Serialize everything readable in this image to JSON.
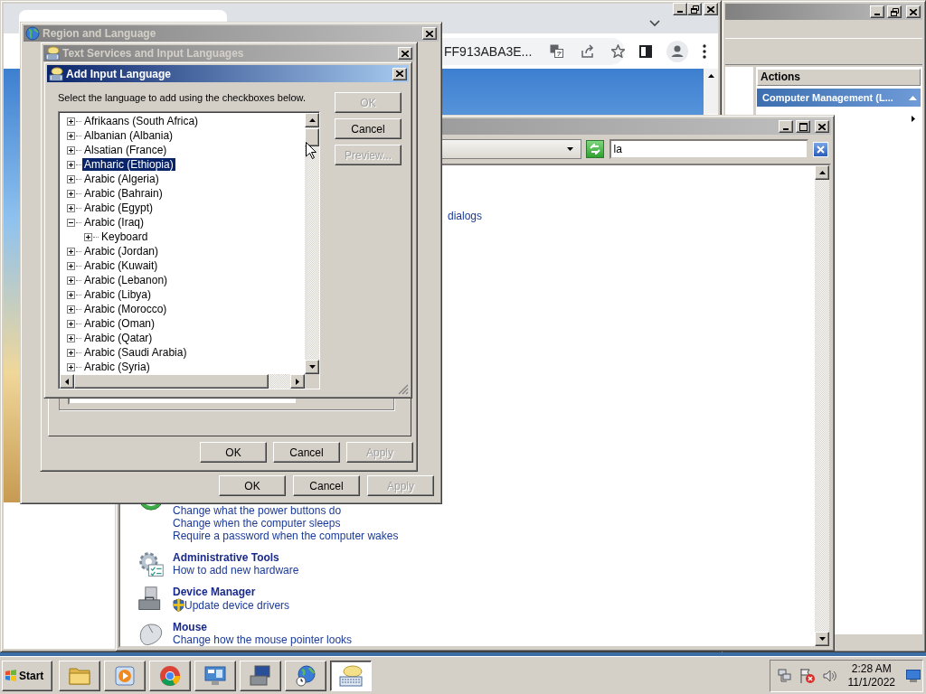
{
  "browser_window": {
    "address_fragment": "FF913ABA3E..."
  },
  "management_window": {
    "actions_heading": "Actions",
    "actions_section": {
      "label": "Computer Management (L...",
      "expanded": true
    }
  },
  "control_panel": {
    "search": {
      "value": "la"
    },
    "link_fragment": "dialogs",
    "sections": [
      {
        "kind": "power",
        "links": [
          {
            "text": "Change what the power buttons do",
            "shield": false
          },
          {
            "text": "Change when the computer sleeps",
            "shield": false
          },
          {
            "text": "Require a password when the computer wakes",
            "shield": false
          }
        ]
      },
      {
        "kind": "admin-tools",
        "title": "Administrative Tools",
        "links": [
          {
            "text": "How to add new hardware",
            "shield": false
          }
        ]
      },
      {
        "kind": "device-manager",
        "title": "Device Manager",
        "links": [
          {
            "text": "Update device drivers",
            "shield": true
          }
        ]
      },
      {
        "kind": "mouse",
        "title": "Mouse",
        "links": [
          {
            "text": "Change how the mouse pointer looks",
            "shield": false
          }
        ]
      }
    ]
  },
  "region_dialog": {
    "title": "Region and Language",
    "buttons": [
      {
        "label": "OK",
        "disabled": false
      },
      {
        "label": "Cancel",
        "disabled": false
      },
      {
        "label": "Apply",
        "disabled": true
      }
    ]
  },
  "text_services_dialog": {
    "title": "Text Services and Input Languages",
    "buttons": [
      {
        "label": "OK",
        "disabled": false
      },
      {
        "label": "Cancel",
        "disabled": false
      },
      {
        "label": "Apply",
        "disabled": true
      }
    ]
  },
  "add_language_dialog": {
    "title": "Add Input Language",
    "instruction": "Select the language to add using the checkboxes below.",
    "languages": [
      {
        "label": "Afrikaans (South Africa)",
        "expanded": false,
        "selected": false
      },
      {
        "label": "Albanian (Albania)",
        "expanded": false,
        "selected": false
      },
      {
        "label": "Alsatian (France)",
        "expanded": false,
        "selected": false
      },
      {
        "label": "Amharic (Ethiopia)",
        "expanded": false,
        "selected": true
      },
      {
        "label": "Arabic (Algeria)",
        "expanded": false,
        "selected": false
      },
      {
        "label": "Arabic (Bahrain)",
        "expanded": false,
        "selected": false
      },
      {
        "label": "Arabic (Egypt)",
        "expanded": false,
        "selected": false
      },
      {
        "label": "Arabic (Iraq)",
        "expanded": true,
        "selected": false,
        "children": [
          {
            "label": "Keyboard",
            "expanded": false,
            "selected": false
          }
        ]
      },
      {
        "label": "Arabic (Jordan)",
        "expanded": false,
        "selected": false
      },
      {
        "label": "Arabic (Kuwait)",
        "expanded": false,
        "selected": false
      },
      {
        "label": "Arabic (Lebanon)",
        "expanded": false,
        "selected": false
      },
      {
        "label": "Arabic (Libya)",
        "expanded": false,
        "selected": false
      },
      {
        "label": "Arabic (Morocco)",
        "expanded": false,
        "selected": false
      },
      {
        "label": "Arabic (Oman)",
        "expanded": false,
        "selected": false
      },
      {
        "label": "Arabic (Qatar)",
        "expanded": false,
        "selected": false
      },
      {
        "label": "Arabic (Saudi Arabia)",
        "expanded": false,
        "selected": false
      },
      {
        "label": "Arabic (Syria)",
        "expanded": false,
        "selected": false
      }
    ],
    "buttons": [
      {
        "label": "OK",
        "disabled": true
      },
      {
        "label": "Cancel",
        "disabled": false
      },
      {
        "label": "Preview...",
        "disabled": true
      }
    ]
  },
  "taskbar": {
    "start_label": "Start",
    "apps": [
      {
        "kind": "folder",
        "selected": false
      },
      {
        "kind": "player",
        "selected": false
      },
      {
        "kind": "browser",
        "selected": false
      },
      {
        "kind": "control-panel",
        "selected": false
      },
      {
        "kind": "computer",
        "selected": false
      },
      {
        "kind": "globe",
        "selected": false
      },
      {
        "kind": "keyboard",
        "selected": true
      }
    ],
    "clock": {
      "time": "2:28 AM",
      "date": "11/1/2022"
    }
  }
}
